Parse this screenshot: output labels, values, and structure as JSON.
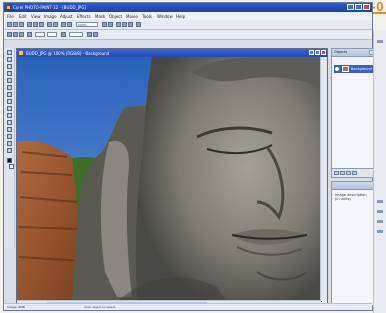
{
  "page_label": "[0-0",
  "window": {
    "title": "Corel PHOTO-PAINT 12 - [BUDD_JPG]",
    "menu": [
      "File",
      "Edit",
      "View",
      "Image",
      "Adjust",
      "Effects",
      "Mask",
      "Object",
      "Movie",
      "Tools",
      "Window",
      "Help"
    ]
  },
  "toolbar2": {
    "zoom": "100%"
  },
  "document": {
    "title": "BUDD_JPG @ 100% (RGB/8) - Background"
  },
  "layers_panel": {
    "title": "Objects",
    "layer_name": "Background"
  },
  "info_panel": {
    "title": "",
    "text": "Image description (in units)"
  },
  "status": {
    "left": "Image: 8MB",
    "middle": "Click object to select"
  },
  "colors": {
    "title_blue": "#1f4cba",
    "accent": "#e08a1e"
  }
}
